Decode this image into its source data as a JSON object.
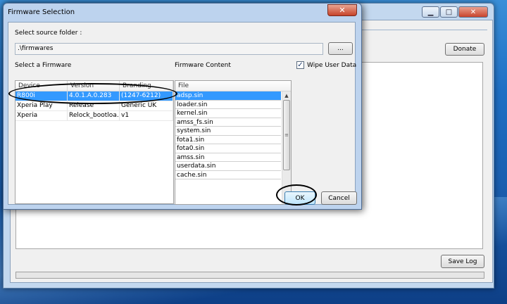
{
  "main_window": {
    "donate_label": "Donate",
    "save_log_label": "Save Log",
    "minimize_glyph": "▁",
    "maximize_glyph": "□",
    "close_glyph": "✕"
  },
  "dialog": {
    "title": "Firmware Selection",
    "close_glyph": "✕",
    "source_folder_label": "Select source folder :",
    "source_folder_value": ".\\firmwares",
    "browse_label": "...",
    "select_firmware_label": "Select a Firmware",
    "firmware_content_label": "Firmware Content",
    "wipe_label": "Wipe User Data",
    "wipe_checked": true,
    "firmware_table": {
      "columns": [
        "Device",
        "Version",
        "Branding"
      ],
      "rows": [
        [
          "R800i",
          "4.0.1.A.0.283",
          "(1247-6212)"
        ],
        [
          "Xperia Play",
          "Release",
          "Generic UK"
        ],
        [
          "Xperia",
          "Relock_bootloa...",
          "v1"
        ]
      ],
      "selected_row": 0
    },
    "content_table": {
      "column": "File",
      "files": [
        "adsp.sin",
        "loader.sin",
        "kernel.sin",
        "amss_fs.sin",
        "system.sin",
        "fota1.sin",
        "fota0.sin",
        "amss.sin",
        "userdata.sin",
        "cache.sin"
      ],
      "selected_index": 0
    },
    "ok_label": "OK",
    "cancel_label": "Cancel"
  },
  "icons": {
    "check": "✓",
    "scroll_up": "▲",
    "scroll_down": "▼",
    "grip": "≡"
  }
}
